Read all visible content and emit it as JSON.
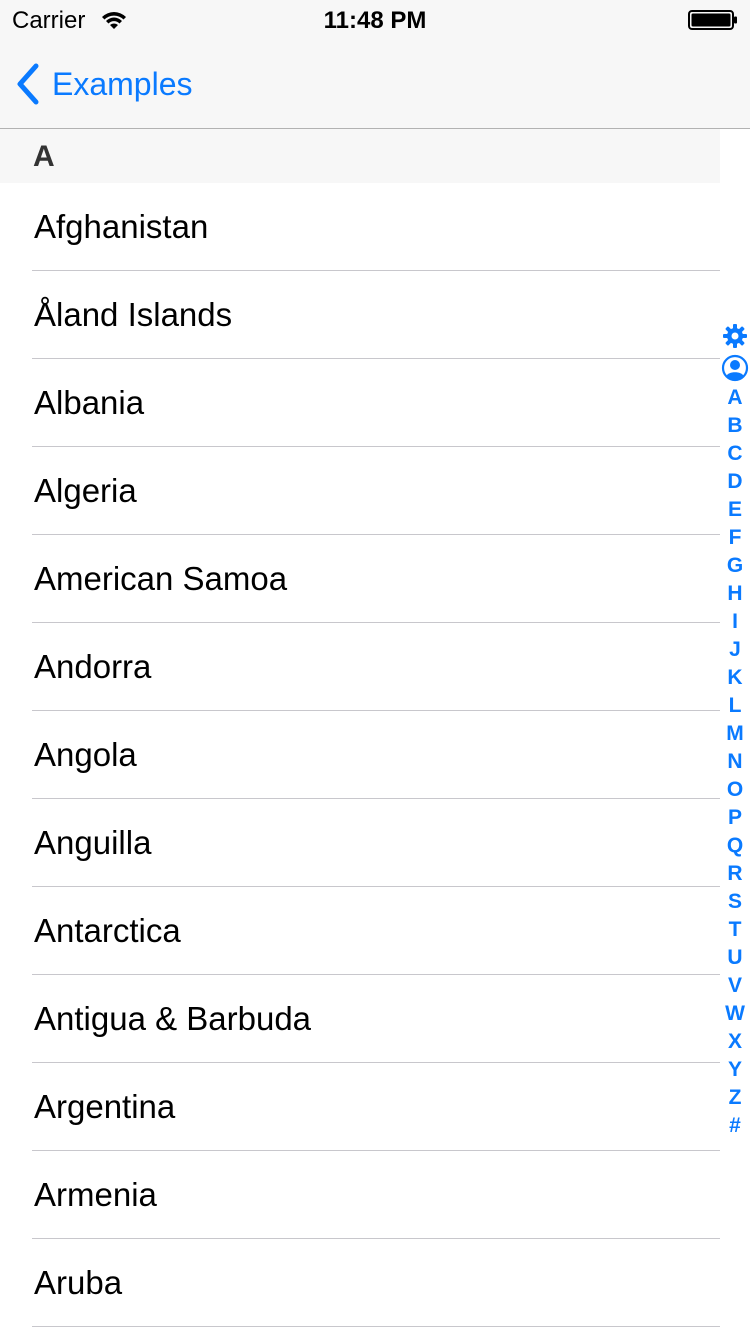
{
  "status_bar": {
    "carrier": "Carrier",
    "time": "11:48 PM",
    "wifi_icon": "wifi-icon",
    "battery_icon": "battery-icon"
  },
  "nav": {
    "back_label": "Examples",
    "back_icon": "chevron-left-icon"
  },
  "colors": {
    "accent": "#0a7aff",
    "bar_background": "#f7f7f7",
    "separator": "#c8c7cc"
  },
  "section": {
    "title": "A",
    "rows": [
      "Afghanistan",
      "Åland Islands",
      "Albania",
      "Algeria",
      "American Samoa",
      "Andorra",
      "Angola",
      "Anguilla",
      "Antarctica",
      "Antigua & Barbuda",
      "Argentina",
      "Armenia",
      "Aruba"
    ]
  },
  "index": {
    "icons": [
      "gear-icon",
      "person-icon"
    ],
    "letters": [
      "A",
      "B",
      "C",
      "D",
      "E",
      "F",
      "G",
      "H",
      "I",
      "J",
      "K",
      "L",
      "M",
      "N",
      "O",
      "P",
      "Q",
      "R",
      "S",
      "T",
      "U",
      "V",
      "W",
      "X",
      "Y",
      "Z",
      "#"
    ]
  }
}
